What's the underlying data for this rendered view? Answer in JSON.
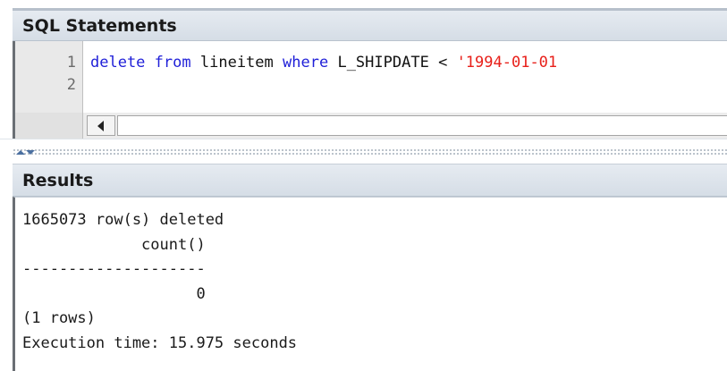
{
  "sql_panel": {
    "title": "SQL Statements",
    "line_numbers": [
      "1",
      "2"
    ],
    "line1": {
      "kw_delete": "delete",
      "kw_from": "from",
      "table": "lineitem",
      "kw_where": "where",
      "column": "L_SHIPDATE",
      "operator": "<",
      "literal": "'1994-01-01"
    }
  },
  "results_panel": {
    "title": "Results",
    "lines": [
      "1665073 row(s) deleted",
      "             count()",
      "--------------------",
      "                   0",
      "(1 rows)",
      "Execution time: 15.975 seconds"
    ]
  }
}
